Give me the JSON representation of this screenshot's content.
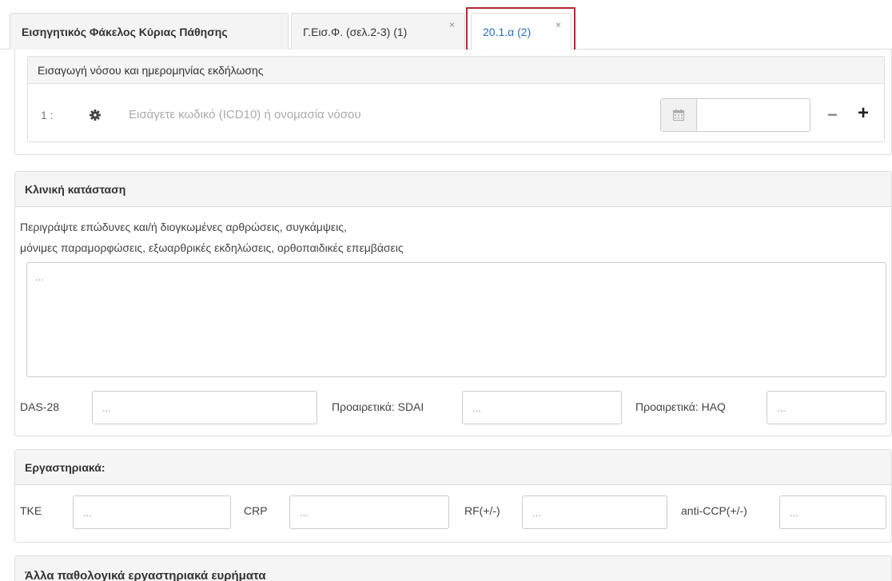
{
  "tabs": [
    {
      "label": "Εισηγητικός Φάκελος Κύριας Πάθησης",
      "closable": false,
      "active": false
    },
    {
      "label": "Γ.Εισ.Φ. (σελ.2-3) (1)",
      "closable": true,
      "active": false
    },
    {
      "label": "20.1.α (2)",
      "closable": true,
      "active": true
    }
  ],
  "close_glyph": "×",
  "disease_section": {
    "header": "Εισαγωγή νόσου και ημερομηνίας εκδήλωσης",
    "row_number": "1 :",
    "placeholder": "Εισάγετε κωδικό (ICD10) ή ονομασία νόσου",
    "date_value": "",
    "remove_label": "−",
    "add_label": "+"
  },
  "clinical": {
    "header": "Κλινική κατάσταση",
    "description_line1": "Περιγράψτε επώδυνες και/ή διογκωμένες αρθρώσεις, συγκάμψεις,",
    "description_line2": "μόνιμες παραμορφώσεις, εξωαρθρικές εκδηλώσεις, ορθοπαιδικές επεμβάσεις",
    "textarea_placeholder": "...",
    "das_label": "DAS-28",
    "das_placeholder": "...",
    "sdai_label": "Προαιρετικά: SDAI",
    "sdai_placeholder": "...",
    "haq_label": "Προαιρετικά: HAQ",
    "haq_placeholder": "..."
  },
  "labs": {
    "header": "Εργαστηριακά:",
    "tke_label": "TKE",
    "tke_placeholder": "...",
    "crp_label": "CRP",
    "crp_placeholder": "...",
    "rf_label": "RF(+/-)",
    "rf_placeholder": "...",
    "ccp_label": "anti-CCP(+/-)",
    "ccp_placeholder": "..."
  },
  "other_labs": {
    "header": "Άλλα παθολογικά εργαστηριακά ευρήματα"
  },
  "colors": {
    "active_tab": "#2a6ebb",
    "highlight": "#b22a32",
    "border": "#dddddd",
    "header_bg": "#f5f5f5"
  }
}
